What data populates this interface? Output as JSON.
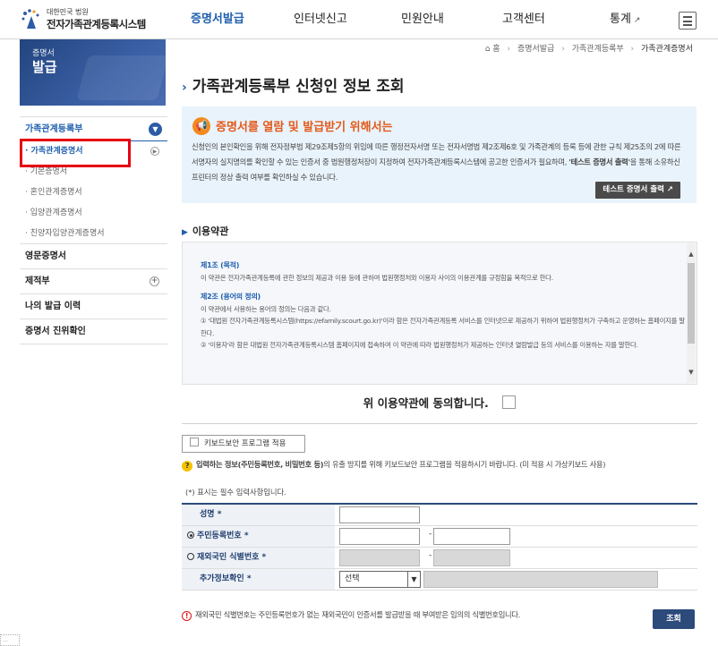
{
  "header": {
    "logo_small": "대한민국 법원",
    "logo_big": "전자가족관계등록시스템",
    "nav": [
      {
        "label": "증명서발급"
      },
      {
        "label": "인터넷신고"
      },
      {
        "label": "민원안내"
      },
      {
        "label": "고객센터"
      },
      {
        "label": "통계"
      }
    ],
    "colors": {
      "accent": "#1f5fae",
      "alert": "#e60012"
    }
  },
  "breadcrumb": {
    "home": "홈",
    "items": [
      "증명서발급",
      "가족관계등록부",
      "가족관계증명서"
    ]
  },
  "sidebar": {
    "banner_small": "증명서",
    "banner_big": "발급",
    "sections": [
      {
        "label": "가족관계등록부"
      },
      {
        "label": "영문증명서"
      },
      {
        "label": "제적부"
      },
      {
        "label": "나의 발급 이력"
      },
      {
        "label": "증명서 진위확인"
      }
    ],
    "subitems": [
      {
        "label": "· 가족관계증명서"
      },
      {
        "label": "· 기본증명서"
      },
      {
        "label": "· 혼인관계증명서"
      },
      {
        "label": "· 입양관계증명서"
      },
      {
        "label": "· 친양자입양관계증명서"
      }
    ]
  },
  "main": {
    "title": "가족관계등록부 신청인 정보 조회",
    "notice": {
      "title": "증명서를 열람 및 발급받기 위해서는",
      "text": "신청인의 본인확인을 위해 전자정부법 제29조제5항의 위임에 따른 행정전자서명 또는 전자서명법 제2조제6호 및 가족관계의 등록 등에 관한 규칙 제25조의 2에 따른 서명자의 실지명의를 확인할 수 있는 인증서 중 법원행정처장이 지정하여 전자가족관계등록시스템에 공고한 인증서가 필요하며, ",
      "text_bold": "'테스트 증명서 출력'",
      "text_tail": "을 통해 소유하신 프린터의 정상 출력 여부를 확인하실 수 있습니다.",
      "button": "테스트 증명서 출력"
    },
    "terms_title": "이용약관",
    "terms": [
      {
        "head": "제1조 (목적)",
        "body": "이 약관은 전자가족관계등록에 관한 정보의 제공과 이용 등에 관하여 법원행정처와 이용자 사이의 이용관계를 규정함을 목적으로 한다."
      },
      {
        "head": "제2조 (용어의 정의)",
        "body": "이 약관에서 사용하는 용어의 정의는 다음과 같다."
      },
      {
        "head": "",
        "body": "① '대법원 전자가족관계등록시스템(https://efamily.scourt.go.kr)'이라 함은 전자가족관계등록 서비스를 인터넷으로 제공하기 위하여 법원행정처가 구축하고 운영하는 홈페이지를 말한다."
      },
      {
        "head": "",
        "body": "② '이용자'라 함은 대법원 전자가족관계등록시스템 홈페이지에 접속하여 이 약관에 따라 법원행정처가 제공하는 인터넷 열람발급 등의 서비스를 이용하는 자를 말한다."
      }
    ],
    "agree_label": "위 이용약관에 동의합니다.",
    "keyboard_button": "키보드보안 프로그램 적용",
    "keyboard_note_bold": "입력하는 정보(주민등록번호, 비밀번호 등)",
    "keyboard_note": "의 유출 방지를 위해 키보드보안 프로그램을 적용하시기 바랍니다. (미 적용 시 가상키보드 사용)",
    "required_note": "(*) 표시는 필수 입력사항입니다.",
    "form": {
      "name_label": "성명 *",
      "rrn_label": "주민등록번호 *",
      "foreign_label": "재외국민 식별번호 *",
      "extra_label": "추가정보확인 *",
      "select_value": "선택"
    },
    "foot_note": "재외국민 식별번호는 주민등록번호가 없는 재외국민이 인증서를 발급받을 때 부여받은 임의의 식별번호입니다.",
    "search_button": "조회",
    "corner_text": "..."
  }
}
